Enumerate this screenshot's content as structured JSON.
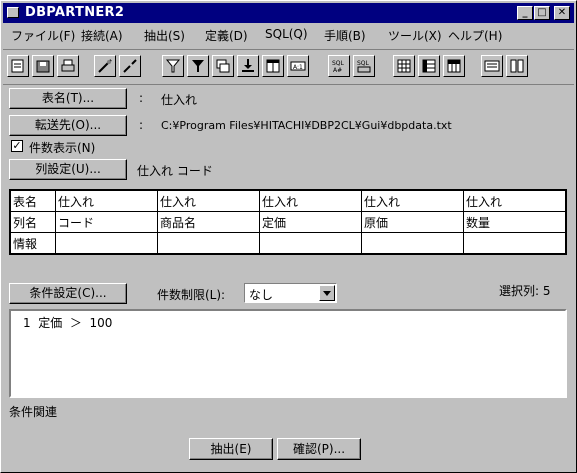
{
  "window": {
    "title": "DBPARTNER2"
  },
  "menu": [
    "ファイル(F)",
    "接続(A)",
    "抽出(S)",
    "定義(D)",
    "SQL(Q)",
    "手順(B)",
    "ツール(X)",
    "ヘルプ(H)"
  ],
  "toolbar_icons": [
    "open-icon",
    "save-icon",
    "print-icon",
    "connect-icon",
    "disconnect-icon",
    "filter-icon",
    "filter2-icon",
    "window-icon",
    "download-icon",
    "table-icon",
    "text-icon",
    "sql-all-icon",
    "sql-select-icon",
    "grid-icon",
    "grid2-icon",
    "grid3-icon",
    "list-icon",
    "book-icon"
  ],
  "table_name": {
    "button": "表名(T)...",
    "sep": ":",
    "value": "仕入れ"
  },
  "dest": {
    "button": "転送先(O)...",
    "sep": ":",
    "value": "C:¥Program Files¥HITACHI¥DBP2CL¥Gui¥dbpdata.txt"
  },
  "count_display": {
    "label": "件数表示(N)",
    "checked": "✓"
  },
  "columns": {
    "button": "列設定(U)...",
    "value": "仕入れ コード"
  },
  "grid": {
    "row_headers": [
      "表名",
      "列名",
      "情報"
    ],
    "tables": [
      "仕入れ",
      "仕入れ",
      "仕入れ",
      "仕入れ",
      "仕入れ"
    ],
    "columns": [
      "コード",
      "商品名",
      "定価",
      "原価",
      "数量"
    ],
    "info": [
      "",
      "",
      "",
      "",
      ""
    ]
  },
  "condition": {
    "button": "条件設定(C)...",
    "limit_label": "件数制限(L):",
    "limit_value": "なし",
    "selected_label": "選択列: 5",
    "lines": [
      "1  定価  ＞  100"
    ]
  },
  "related_label": "条件関連",
  "actions": {
    "extract": "抽出(E)",
    "confirm": "確認(P)..."
  }
}
